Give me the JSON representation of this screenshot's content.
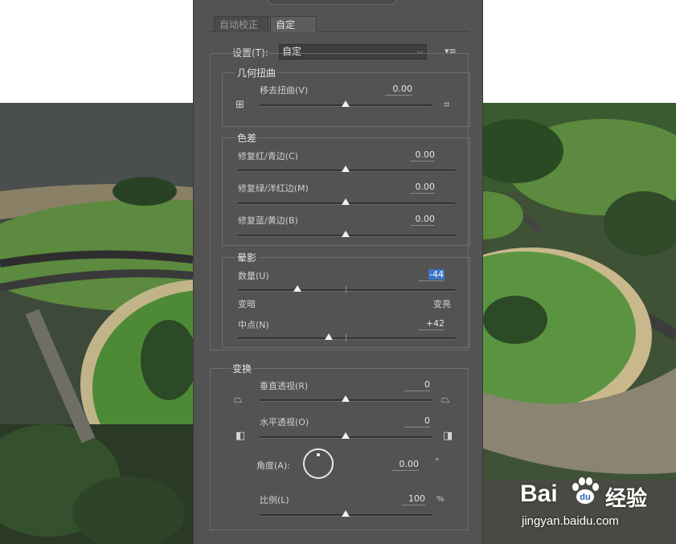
{
  "tabs": [
    "自动校正",
    "自定"
  ],
  "settings": {
    "label": "设置(T):",
    "value": "自定"
  },
  "geometric": {
    "title": "几何扭曲",
    "remove_distortion": {
      "label": "移去扭曲(V)",
      "value": "0.00",
      "level": 0.5
    }
  },
  "chromatic": {
    "title": "色差",
    "fix_red_cyan": {
      "label": "修复红/青边(C)",
      "value": "0.00",
      "level": 0.5
    },
    "fix_green_magenta": {
      "label": "修复绿/洋红边(M)",
      "value": "0.00",
      "level": 0.5
    },
    "fix_blue_yellow": {
      "label": "修复蓝/黄边(B)",
      "value": "0.00",
      "level": 0.5
    }
  },
  "vignette": {
    "title": "晕影",
    "amount": {
      "label": "数量(U)",
      "value": "-44",
      "level": 0.28
    },
    "darken_label": "变暗",
    "lighten_label": "变亮",
    "midpoint": {
      "label": "中点(N)",
      "value": "+42",
      "level": 0.42
    }
  },
  "transform": {
    "title": "变换",
    "vertical_perspective": {
      "label": "垂直透视(R)",
      "value": "0",
      "level": 0.5
    },
    "horizontal_perspective": {
      "label": "水平透视(O)",
      "value": "0",
      "level": 0.5
    },
    "angle": {
      "label": "角度(A):",
      "value": "0.00",
      "unit": "°"
    },
    "scale": {
      "label": "比例(L)",
      "value": "100",
      "unit": "%",
      "level": 0.5
    }
  },
  "watermark": {
    "brand_a": "Bai",
    "brand_b": "du",
    "brand_cn": "经验",
    "url": "jingyan.baidu.com"
  },
  "colors": {
    "panel": "#535353",
    "highlight": "#3c75c4"
  }
}
